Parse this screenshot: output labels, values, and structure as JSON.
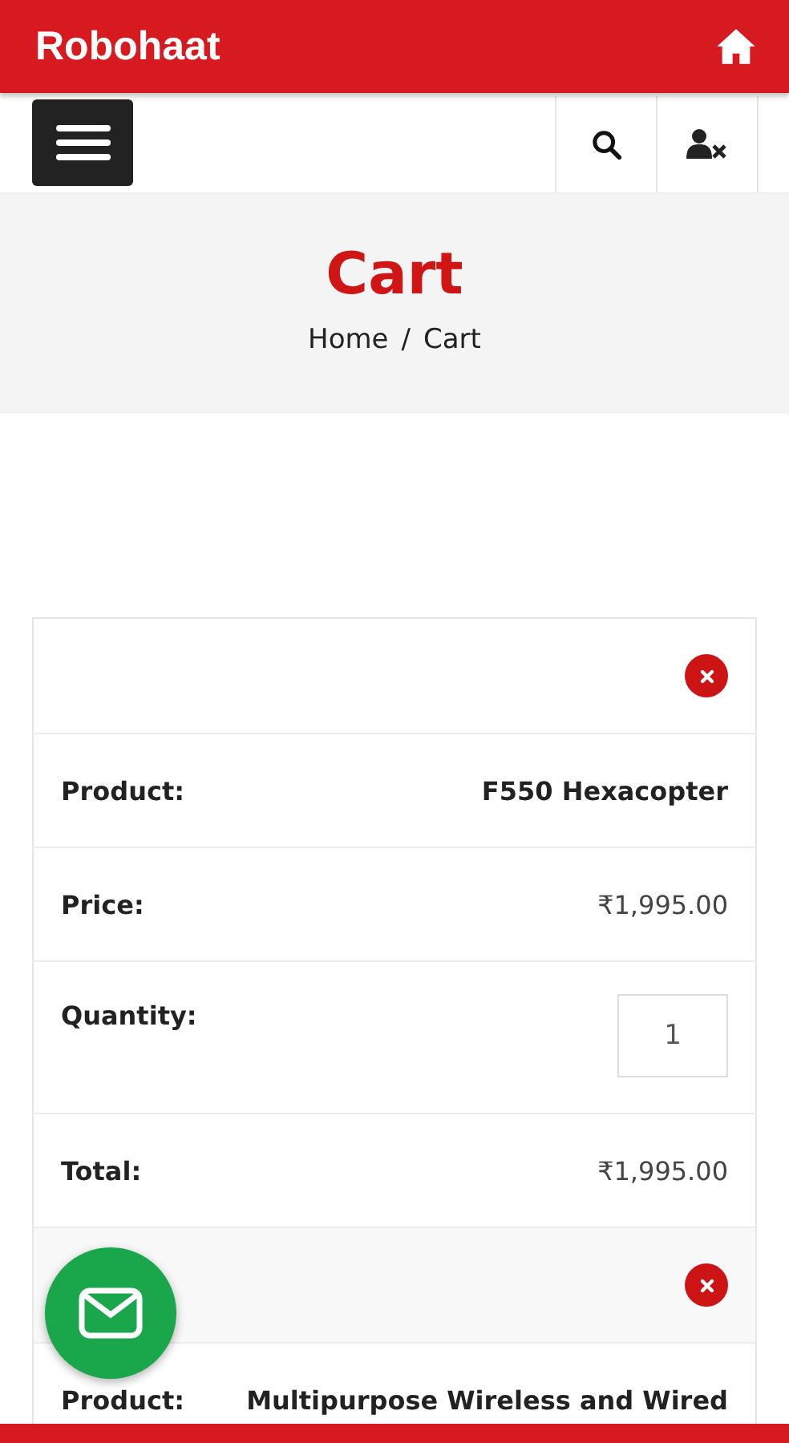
{
  "app_bar": {
    "title": "Robohaat"
  },
  "page_title": "Cart",
  "breadcrumb": [
    "Home",
    "/",
    "Cart"
  ],
  "cart_items": [
    {
      "rows": [
        {
          "kind": "name",
          "label": "Product:",
          "value": "F550 Hexacopter"
        },
        {
          "kind": "price",
          "label": "Price:",
          "value": "₹1,995.00"
        },
        {
          "kind": "quantity",
          "label": "Quantity:",
          "value": "1"
        },
        {
          "kind": "price",
          "label": "Total:",
          "value": "₹1,995.00"
        }
      ]
    },
    {
      "rows": [
        {
          "kind": "name",
          "label": "Product:",
          "value": "Multipurpose Wireless and Wired"
        }
      ]
    }
  ]
}
